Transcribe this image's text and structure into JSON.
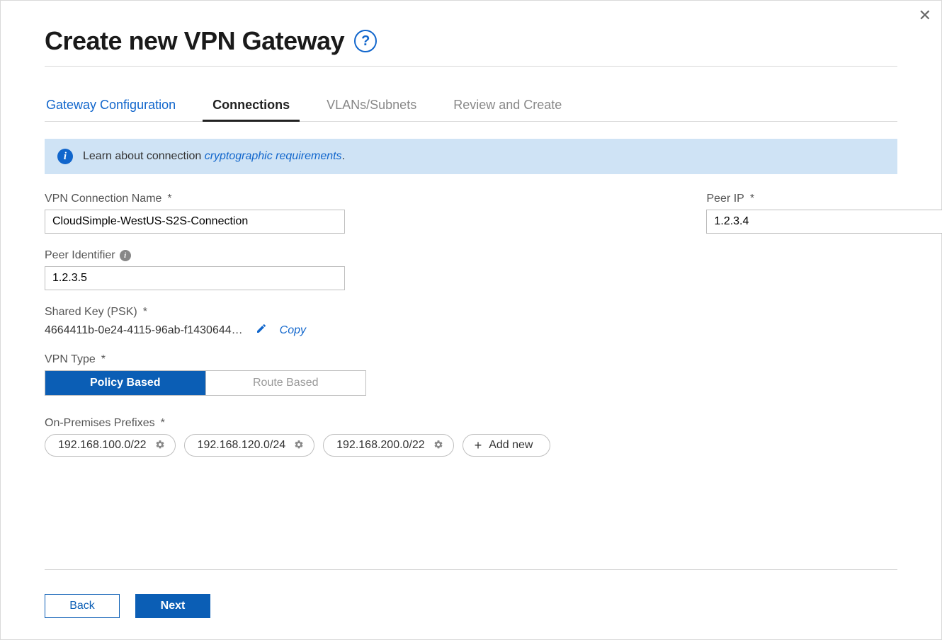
{
  "title": "Create new VPN Gateway",
  "tabs": [
    {
      "label": "Gateway Configuration",
      "state": "completed"
    },
    {
      "label": "Connections",
      "state": "active"
    },
    {
      "label": "VLANs/Subnets",
      "state": "default"
    },
    {
      "label": "Review and Create",
      "state": "default"
    }
  ],
  "banner": {
    "prefix": "Learn about connection ",
    "link": "cryptographic requirements",
    "suffix": "."
  },
  "labels": {
    "vpn_connection_name": "VPN Connection Name",
    "peer_ip": "Peer IP",
    "peer_identifier": "Peer Identifier",
    "shared_key": "Shared Key  (PSK)",
    "vpn_type": "VPN Type",
    "on_prem_prefixes": "On-Premises Prefixes",
    "required": "*"
  },
  "values": {
    "vpn_connection_name": "CloudSimple-WestUS-S2S-Connection",
    "peer_ip": "1.2.3.4",
    "peer_identifier": "1.2.3.5",
    "shared_key_display": "4664411b-0e24-4115-96ab-f1430644…"
  },
  "actions": {
    "copy": "Copy",
    "add_new": "Add new",
    "back": "Back",
    "next": "Next"
  },
  "vpn_type_options": [
    {
      "label": "Policy Based",
      "selected": true
    },
    {
      "label": "Route Based",
      "selected": false
    }
  ],
  "prefixes": [
    "192.168.100.0/22",
    "192.168.120.0/24",
    "192.168.200.0/22"
  ]
}
